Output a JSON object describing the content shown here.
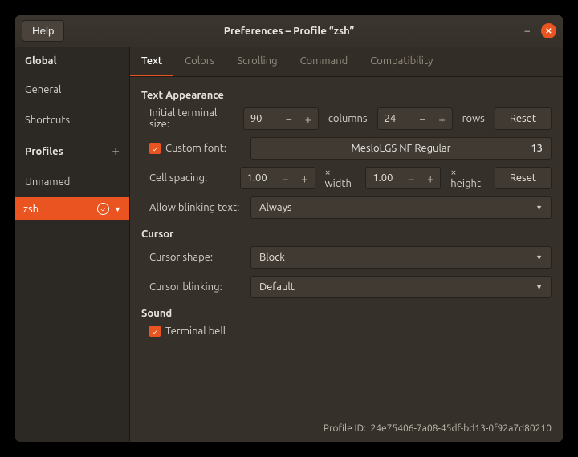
{
  "titlebar": {
    "help": "Help",
    "title": "Preferences – Profile “zsh”"
  },
  "sidebar": {
    "global": "Global",
    "items": [
      "General",
      "Shortcuts"
    ],
    "profiles": "Profiles",
    "profileItems": [
      "Unnamed",
      "zsh"
    ]
  },
  "tabs": [
    "Text",
    "Colors",
    "Scrolling",
    "Command",
    "Compatibility"
  ],
  "text": {
    "section_appearance": "Text Appearance",
    "initial_size_label": "Initial terminal size:",
    "cols_value": "90",
    "cols_unit": "columns",
    "rows_value": "24",
    "rows_unit": "rows",
    "reset": "Reset",
    "custom_font_label": "Custom font:",
    "font_name": "MesloLGS NF Regular",
    "font_size": "13",
    "cell_spacing_label": "Cell spacing:",
    "cell_w": "1.00",
    "cell_w_unit": "× width",
    "cell_h": "1.00",
    "cell_h_unit": "× height",
    "blink_label": "Allow blinking text:",
    "blink_value": "Always",
    "section_cursor": "Cursor",
    "cursor_shape_label": "Cursor shape:",
    "cursor_shape_value": "Block",
    "cursor_blink_label": "Cursor blinking:",
    "cursor_blink_value": "Default",
    "section_sound": "Sound",
    "terminal_bell": "Terminal bell"
  },
  "footer": {
    "label": "Profile ID:",
    "value": "24e75406-7a08-45df-bd13-0f92a7d80210"
  }
}
